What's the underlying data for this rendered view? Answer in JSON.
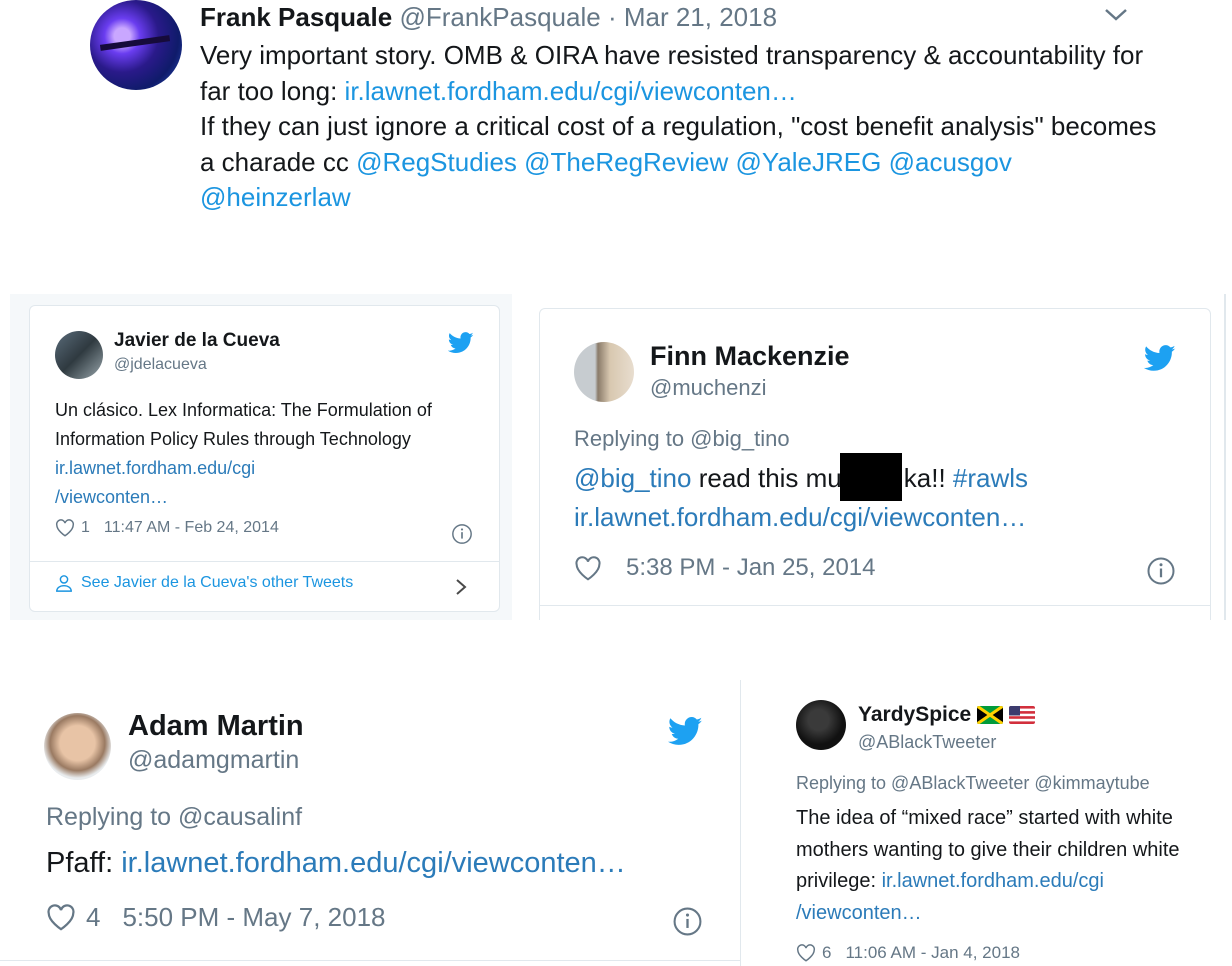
{
  "tweet_top": {
    "name": "Frank Pasquale",
    "handle": "@FrankPasquale",
    "sep": " · ",
    "date": "Mar 21, 2018",
    "text_1": "Very important story. OMB & OIRA have resisted transparency & accountability for far too long: ",
    "link_1": "ir.lawnet.fordham.edu/cgi/viewconten…",
    "text_2": "If they can just ignore a critical cost of a regulation, \"cost benefit analysis\" becomes a charade cc ",
    "mentions": [
      "@RegStudies",
      "@TheRegReview",
      "@YaleJREG",
      "@acusgov",
      "@heinzerlaw"
    ]
  },
  "card_javier": {
    "name": "Javier de la Cueva",
    "handle": "@jdelacueva",
    "text": "Un clásico. Lex Informatica: The Formulation of Information Policy Rules through Technology ",
    "link_a": "ir.lawnet.fordham.edu/cgi",
    "link_b": "/viewconten…",
    "likes": "1",
    "time": "11:47 AM - Feb 24, 2014",
    "more": "See Javier de la Cueva's other Tweets"
  },
  "card_finn": {
    "name": "Finn Mackenzie",
    "handle": "@muchenzi",
    "replying": "Replying to @big_tino",
    "mention": "@big_tino",
    "text_a": " read this mu",
    "text_b": "ka!! ",
    "hashtag": "#rawls",
    "link": "ir.lawnet.fordham.edu/cgi/viewconten…",
    "time": "5:38 PM - Jan 25, 2014"
  },
  "tweet_adam": {
    "name": "Adam Martin",
    "handle": "@adamgmartin",
    "replying": "Replying to @causalinf",
    "text": "Pfaff: ",
    "link": "ir.lawnet.fordham.edu/cgi/viewconten…",
    "likes": "4",
    "time": "5:50 PM - May 7, 2018"
  },
  "tweet_yardy": {
    "name": "YardySpice",
    "handle": "@ABlackTweeter",
    "replying": "Replying to @ABlackTweeter @kimmaytube",
    "text": "The idea of “mixed race” started with white mothers wanting to give their children white privilege: ",
    "link_a": "ir.lawnet.fordham.edu/cgi",
    "link_b": "/viewconten…",
    "likes": "6",
    "time": "11:06 AM - Jan 4, 2018"
  },
  "colors": {
    "link": "#1b95e0",
    "muted": "#657786",
    "twitter_blue": "#1da1f2",
    "border": "#e1e8ed"
  },
  "icons": [
    "chevron-down-icon",
    "twitter-bird-icon",
    "heart-icon",
    "info-icon",
    "person-icon",
    "chevron-right-icon",
    "jamaica-flag-icon",
    "us-flag-icon"
  ]
}
